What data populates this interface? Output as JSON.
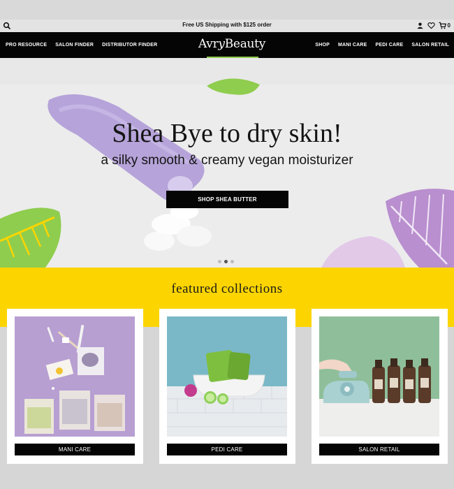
{
  "topbar": {
    "promo": "Free US Shipping with $125 order",
    "icons": [
      "search-icon",
      "user-icon",
      "heart-icon",
      "cart-icon"
    ],
    "cart_count": "0"
  },
  "nav": {
    "left_items": [
      "PRO RESOURCE",
      "SALON FINDER",
      "DISTRIBUTOR FINDER"
    ],
    "logo": {
      "part1": "Avr",
      "part2": "y",
      "part3": "Beauty"
    },
    "right_items": [
      "SHOP",
      "MANI CARE",
      "PEDI CARE",
      "SALON RETAIL"
    ]
  },
  "hero": {
    "headline": "Shea Bye to dry skin!",
    "subline": "a silky smooth & creamy vegan moisturizer",
    "cta": "SHOP SHEA BUTTER",
    "slides": 3,
    "active_slide": 2
  },
  "featured": {
    "title": "featured collections",
    "cards": [
      {
        "label": "MANI CARE",
        "bg": "#b79fd2"
      },
      {
        "label": "PEDI CARE",
        "bg": "#7ab8c8"
      },
      {
        "label": "SALON RETAIL",
        "bg": "#8fbf9a"
      }
    ]
  },
  "colors": {
    "accent_yellow": "#fcd500",
    "leaf_green": "#8fcd4e",
    "leaf_purple": "#b98fcf",
    "nav_bg": "#050505"
  }
}
